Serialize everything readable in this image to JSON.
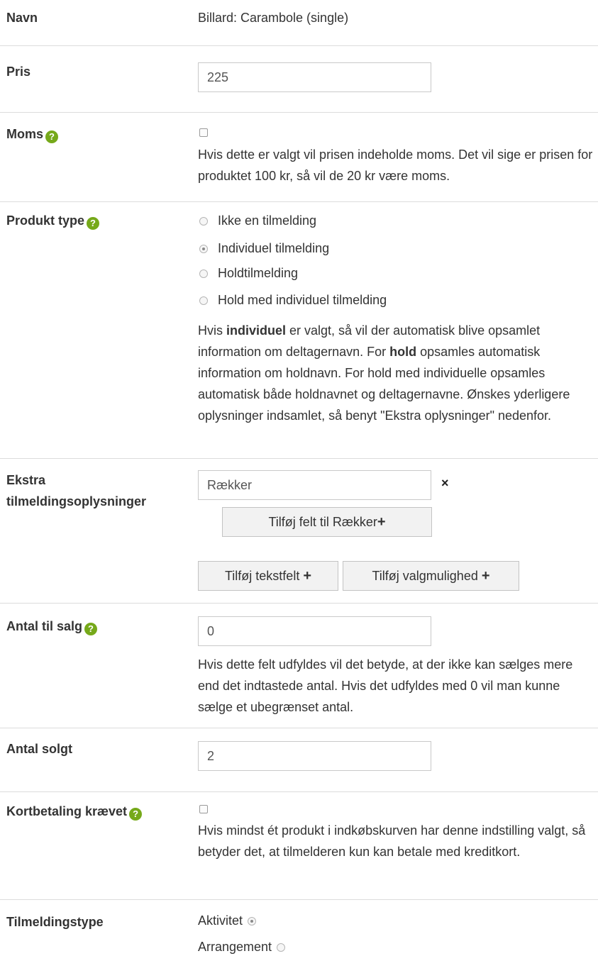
{
  "navn": {
    "label": "Navn",
    "value": "Billard: Carambole (single)"
  },
  "pris": {
    "label": "Pris",
    "value": "225"
  },
  "moms": {
    "label": "Moms",
    "help_icon": "?",
    "checked": false,
    "help_text": "Hvis dette er valgt vil prisen indeholde moms. Det vil sige er prisen for produktet 100 kr, så vil de 20 kr være moms."
  },
  "produkt_type": {
    "label": "Produkt type",
    "help_icon": "?",
    "options": [
      {
        "label": "Ikke en tilmelding",
        "selected": false
      },
      {
        "label": "Individuel tilmelding",
        "selected": true
      },
      {
        "label": "Holdtilmelding",
        "selected": false
      },
      {
        "label": "Hold med individuel tilmelding",
        "selected": false
      }
    ],
    "help_text": {
      "p1": "Hvis ",
      "b1": "individuel",
      "p2": " er valgt, så vil der automatisk blive opsamlet information om deltagernavn. For ",
      "b2": "hold",
      "p3": " opsamles automatisk information om holdnavn. For hold med individuelle opsamles automatisk både holdnavnet og deltagernavne. Ønskes yderligere oplysninger indsamlet, så benyt \"Ekstra oplysninger\" nedenfor."
    }
  },
  "ekstra": {
    "label_line1": "Ekstra",
    "label_line2": "tilmeldingsoplysninger",
    "field_value": "Rækker",
    "remove_icon": "×",
    "add_field_button": "Tilføj felt til Rækker",
    "add_text_button": "Tilføj tekstfelt",
    "add_choice_button": "Tilføj valgmulighed",
    "plus_icon": "+"
  },
  "antal_til_salg": {
    "label": "Antal til salg",
    "help_icon": "?",
    "value": "0",
    "help_text": "Hvis dette felt udfyldes vil det betyde, at der ikke kan sælges mere end det indtastede antal. Hvis det udfyldes med 0 vil man kunne sælge et ubegrænset antal."
  },
  "antal_solgt": {
    "label": "Antal solgt",
    "value": "2"
  },
  "kortbetaling": {
    "label": "Kortbetaling krævet",
    "help_icon": "?",
    "checked": false,
    "help_text": "Hvis mindst ét produkt i indkøbskurven har denne indstilling valgt, så betyder det, at tilmelderen kun kan betale med kreditkort."
  },
  "tilmeldingstype": {
    "label": "Tilmeldingstype",
    "options": [
      {
        "label": "Aktivitet",
        "selected": true
      },
      {
        "label": "Arrangement",
        "selected": false
      }
    ]
  },
  "colors": {
    "help_badge": "#76a91a",
    "separator": "#dcdcdc",
    "text": "#333333"
  }
}
